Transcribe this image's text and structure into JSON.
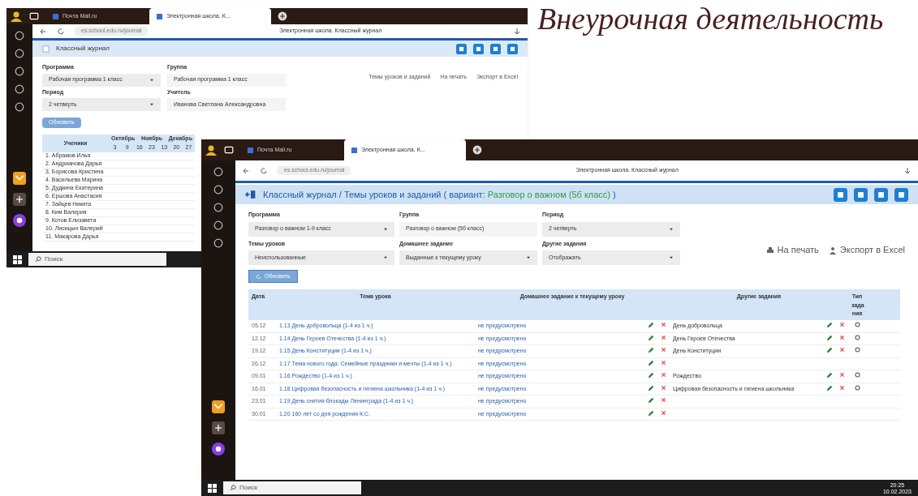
{
  "slide_title": "Внеурочная деятельность",
  "back_window": {
    "tabs": [
      {
        "label": "Почта Mail.ru",
        "selected": false
      },
      {
        "label": "Электронная школа. К...",
        "selected": true
      }
    ],
    "address": "es.school.edu.ru/journal",
    "page_title": "Электронная школа. Классный журнал",
    "header": "Классный журнал",
    "filters": [
      {
        "label": "Программа",
        "value": "Рабочая программа 1 класс",
        "kind": "select"
      },
      {
        "label": "Группа",
        "value": "Рабочая программа 1 класс",
        "kind": "text"
      },
      {
        "label": "Период",
        "value": "2 четверть",
        "kind": "select"
      },
      {
        "label": "Учитель",
        "value": "Иванова Светлана Александровна",
        "kind": "text"
      }
    ],
    "button": "Обновить",
    "links": [
      "Темы уроков и заданий",
      "На печать",
      "Экспорт в Excel"
    ],
    "journal": {
      "student_heading": "Ученики",
      "months": [
        "Октябрь",
        "Ноябрь",
        "Декабрь"
      ],
      "days": [
        "3",
        "9",
        "16",
        "23",
        "13",
        "20",
        "27"
      ],
      "students": [
        "1. Абрамов Илья",
        "2. Андрианова Дарья",
        "3. Борисова Кристина",
        "4. Васильева Марина",
        "5. Дудкина Екатерина",
        "6. Ершова Анастасия",
        "7. Зайцев Никита",
        "8. Ким Валерия",
        "9. Котов Елизавета",
        "10. Лисицын Валерий",
        "11. Макарова Дарья"
      ]
    },
    "taskbar": {
      "search": "Поиск"
    }
  },
  "front_window": {
    "tabs": [
      {
        "label": "Почта Mail.ru",
        "selected": false
      },
      {
        "label": "Электронная школа. К...",
        "selected": true
      }
    ],
    "address": "es.school.edu.ru/journal",
    "page_title": "Электронная школа. Классный журнал",
    "header_prefix": "Классный журнал / Темы уроков и заданий ( вариант: ",
    "header_variant": "Разговор о важном (5б класс)",
    "header_suffix": " )",
    "filters": [
      {
        "label": "Программа",
        "value": "Разговор о важном 1-9 класс",
        "kind": "select"
      },
      {
        "label": "Группа",
        "value": "Разговор о важном (5б класс)",
        "kind": "text"
      },
      {
        "label": "Период",
        "value": "2 четверть",
        "kind": "select"
      },
      {
        "label": "Темы уроков",
        "value": "Неиспользованные",
        "kind": "select"
      },
      {
        "label": "Домашнее задание",
        "value": "Выданные к текущему уроку",
        "kind": "select"
      },
      {
        "label": "Другие задания",
        "value": "Отображать",
        "kind": "select"
      }
    ],
    "button": "Обновить",
    "links": [
      "На печать",
      "Экспорт в Excel"
    ],
    "table": {
      "columns": [
        "Дата",
        "Тема урока",
        "Домашнее задание к текущему уроку",
        "Другие задания",
        "Тип зада ния"
      ],
      "rows": [
        {
          "date": "05.12",
          "topic": "1.13 День добровольца (1-4 из 1 ч.)",
          "homework": "не предусмотрено",
          "other": "День добровольца"
        },
        {
          "date": "12.12",
          "topic": "1.14 День Героев Отечества (1-4 из 1 ч.)",
          "homework": "не предусмотрено",
          "other": "День Героев Отечества"
        },
        {
          "date": "19.12",
          "topic": "1.15 День Конституции (1-4 из 1 ч.)",
          "homework": "не предусмотрено",
          "other": "День Конституции"
        },
        {
          "date": "26.12",
          "topic": "1.17 Тема нового года. Семейные праздники и мечты (1-4 из 1 ч.)",
          "homework": "не предусмотрено"
        },
        {
          "date": "09.01",
          "topic": "1.16 Рождество (1-4 из 1 ч.)",
          "homework": "не предусмотрено",
          "other": "Рождество"
        },
        {
          "date": "16.01",
          "topic": "1.18 Цифровая безопасность и гигиена школьника (1-4 из 1 ч.)",
          "homework": "не предусмотрено",
          "other": "Цифровая безопасность и гигиена школьника"
        },
        {
          "date": "23.01",
          "topic": "1.19 День снятия блокады Ленинграда (1-4 из 1 ч.)",
          "homework": "не предусмотрено"
        },
        {
          "date": "30.01",
          "topic": "1.20 160 лет со дня рождения К.С.",
          "homework": "не предусмотрено"
        }
      ]
    },
    "taskbar": {
      "search": "Поиск",
      "time": "20:25",
      "date": "10.02.2023"
    }
  }
}
